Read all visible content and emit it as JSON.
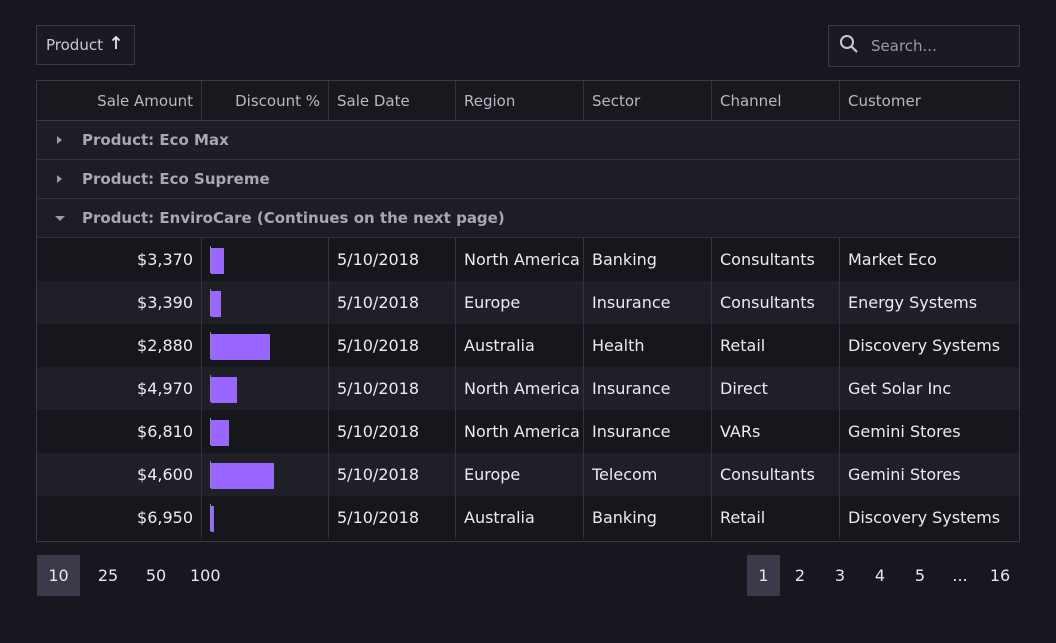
{
  "grouping": {
    "label": "Product",
    "sort_icon": "arrow-up-icon"
  },
  "search": {
    "placeholder": "Search...",
    "value": "",
    "icon": "search-icon"
  },
  "columns": [
    "Sale Amount",
    "Discount %",
    "Sale Date",
    "Region",
    "Sector",
    "Channel",
    "Customer"
  ],
  "groups": [
    {
      "label": "Product: Eco Max",
      "expanded": false
    },
    {
      "label": "Product: Eco Supreme",
      "expanded": false
    },
    {
      "label": "Product: EnviroCare (Continues on the next page)",
      "expanded": true
    }
  ],
  "rows": [
    {
      "amount": "$3,370",
      "discount_pct": 0.2,
      "date": "5/10/2018",
      "region": "North America",
      "sector": "Banking",
      "channel": "Consultants",
      "customer": "Market Eco"
    },
    {
      "amount": "$3,390",
      "discount_pct": 0.15,
      "date": "5/10/2018",
      "region": "Europe",
      "sector": "Insurance",
      "channel": "Consultants",
      "customer": "Energy Systems"
    },
    {
      "amount": "$2,880",
      "discount_pct": 0.9,
      "date": "5/10/2018",
      "region": "Australia",
      "sector": "Health",
      "channel": "Retail",
      "customer": "Discovery Systems"
    },
    {
      "amount": "$4,970",
      "discount_pct": 0.4,
      "date": "5/10/2018",
      "region": "North America",
      "sector": "Insurance",
      "channel": "Direct",
      "customer": "Get Solar Inc"
    },
    {
      "amount": "$6,810",
      "discount_pct": 0.28,
      "date": "5/10/2018",
      "region": "North America",
      "sector": "Insurance",
      "channel": "VARs",
      "customer": "Gemini Stores"
    },
    {
      "amount": "$4,600",
      "discount_pct": 0.95,
      "date": "5/10/2018",
      "region": "Europe",
      "sector": "Telecom",
      "channel": "Consultants",
      "customer": "Gemini Stores"
    },
    {
      "amount": "$6,950",
      "discount_pct": 0.05,
      "date": "5/10/2018",
      "region": "Australia",
      "sector": "Banking",
      "channel": "Retail",
      "customer": "Discovery Systems"
    }
  ],
  "page_sizes": [
    "10",
    "25",
    "50",
    "100"
  ],
  "selected_page_size": "10",
  "pages": [
    "1",
    "2",
    "3",
    "4",
    "5",
    "...",
    "16"
  ],
  "current_page": "1",
  "colors": {
    "bar": "#9966ff",
    "background": "#17171f",
    "selected": "#3a3a4a"
  }
}
